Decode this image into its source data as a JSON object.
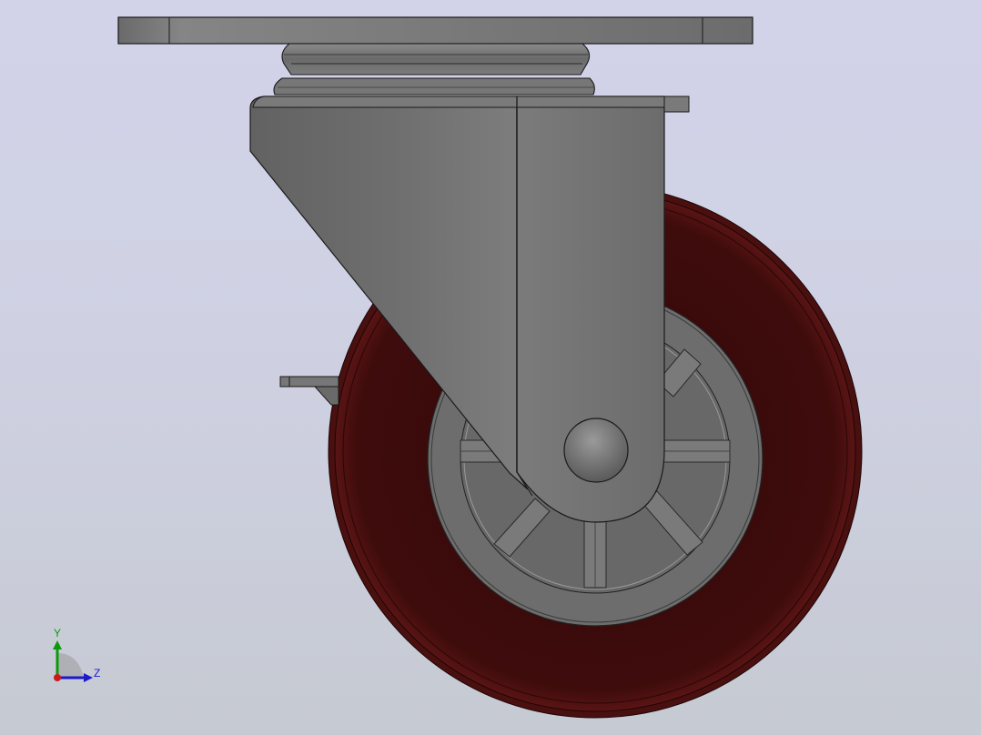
{
  "view": {
    "background_top": "#d2d3e9",
    "background_bottom": "#c6cad2"
  },
  "model": {
    "name": "swivel-caster-with-brake",
    "colors": {
      "tire": "#3a0909",
      "tire_edge": "#5c1212",
      "hub": "#6e6e6e",
      "bracket": "#717171",
      "plate": "#777777",
      "outline": "#1a1a1a"
    }
  },
  "triad": {
    "y_label": "Y",
    "z_label": "Z",
    "y_color": "#0a9a0a",
    "z_color": "#1a1acc",
    "x_color": "#cc1a1a"
  }
}
